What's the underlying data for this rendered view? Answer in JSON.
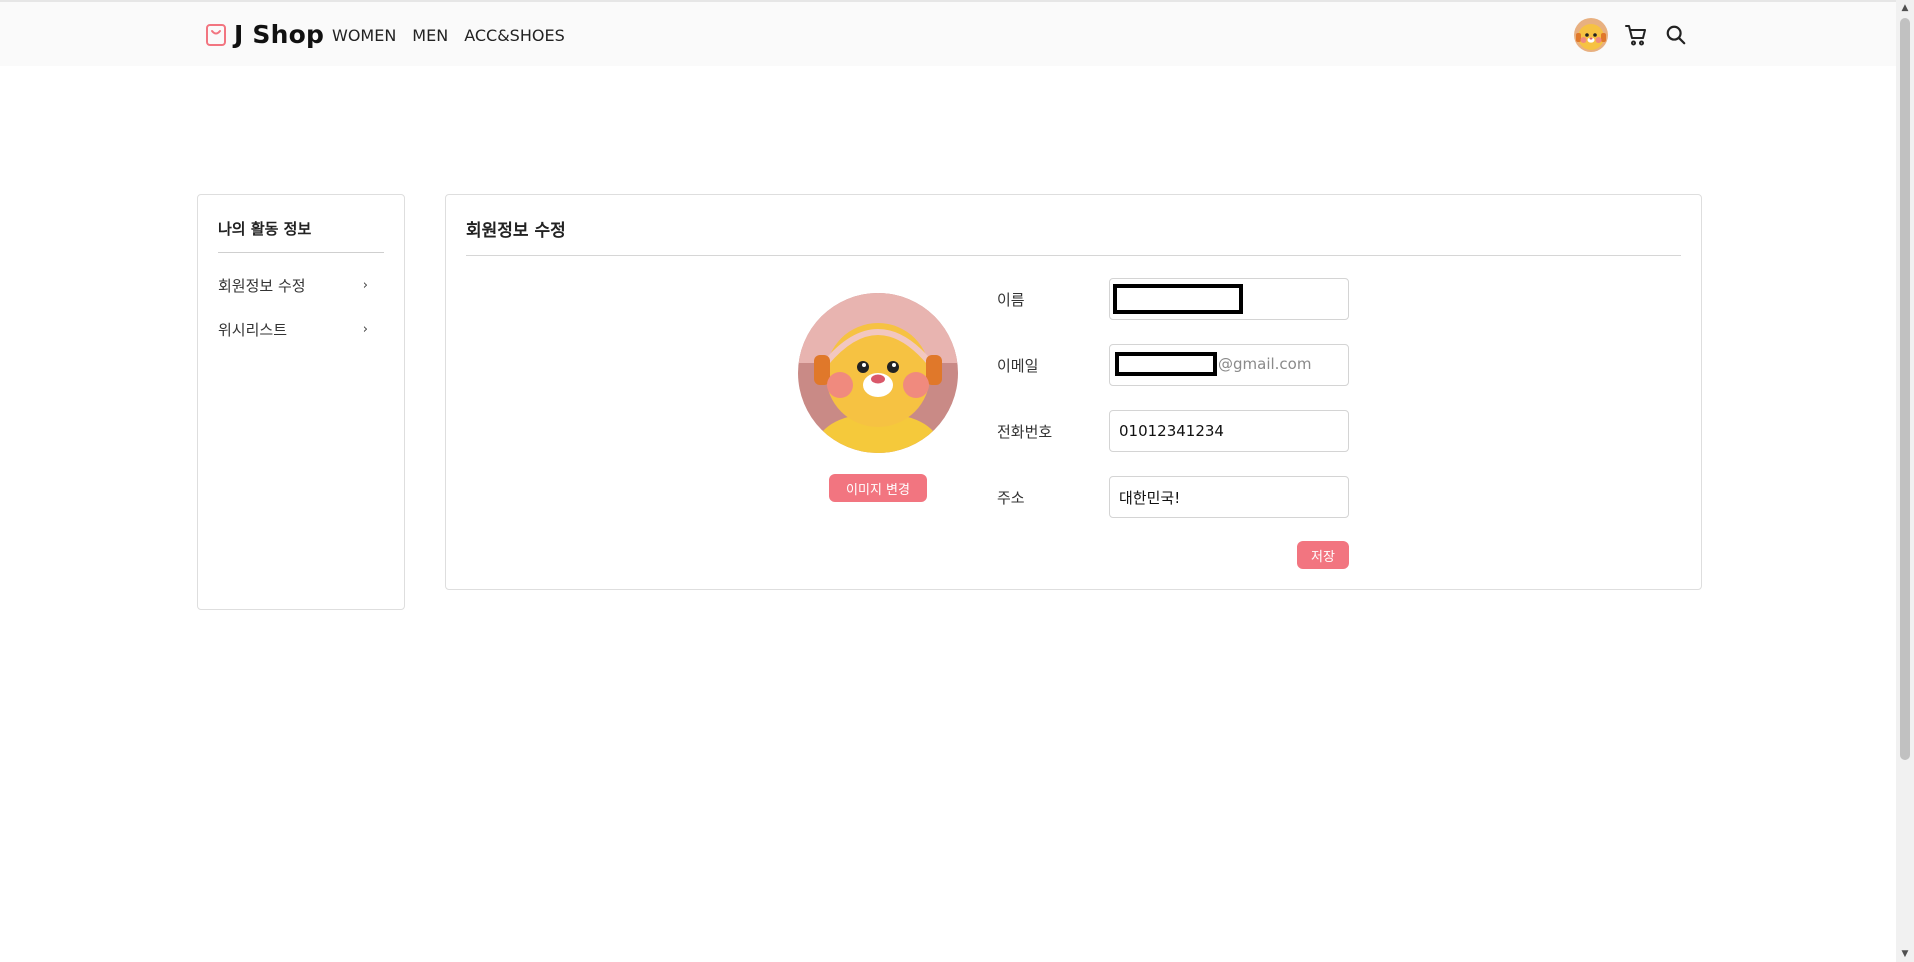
{
  "header": {
    "brand": "J Shop",
    "nav": [
      "WOMEN",
      "MEN",
      "ACC&SHOES"
    ],
    "icons": [
      "user-avatar",
      "cart-icon",
      "search-icon"
    ]
  },
  "sidebar": {
    "title": "나의 활동 정보",
    "items": [
      {
        "label": "회원정보 수정",
        "chevron": "›"
      },
      {
        "label": "위시리스트",
        "chevron": "›"
      }
    ]
  },
  "main": {
    "title": "회원정보 수정",
    "change_image_label": "이미지 변경",
    "form": {
      "name_label": "이름",
      "name_value": "",
      "email_label": "이메일",
      "email_suffix": "@gmail.com",
      "phone_label": "전화번호",
      "phone_value": "01012341234",
      "address_label": "주소",
      "address_value": "대한민국!"
    },
    "save_label": "저장"
  },
  "colors": {
    "accent": "#f27580",
    "header_bg": "#fafafa",
    "border": "#dedede"
  }
}
